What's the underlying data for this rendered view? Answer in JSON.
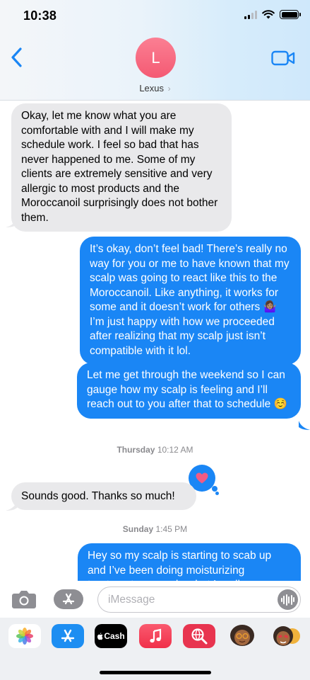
{
  "status_bar": {
    "time": "10:38"
  },
  "header": {
    "avatar_initial": "L",
    "contact_name": "Lexus",
    "name_chevron": "›"
  },
  "messages": [
    {
      "direction": "incoming",
      "text": "Okay, let me know what you are comfortable with and I will make my schedule work. I feel so bad that has never happened to me. Some of my clients are extremely sensitive and very allergic to most products and the Moroccanoil surprisingly does not bother them."
    },
    {
      "direction": "outgoing",
      "text": "It’s okay, don’t feel bad! There’s really no way for you or me to have known that my scalp was going to react like this to the Moroccanoil. Like anything, it works for some and it doesn’t work for others 🤷🏽‍♀️ I’m just happy with how we proceeded after realizing that my scalp just isn’t compatible with it lol."
    },
    {
      "direction": "outgoing",
      "text": "Let me get through the weekend so I can gauge how my scalp is feeling and I’ll reach out to you after that to schedule ☺️"
    },
    {
      "direction": "incoming",
      "text": "Sounds good. Thanks so much!",
      "tapback": "heart"
    },
    {
      "direction": "outgoing",
      "text": "Hey so my scalp is starting to scab up and I’ve been doing moisturizing treatments every day, but I really"
    }
  ],
  "timestamps": [
    {
      "day": "Thursday",
      "time": "10:12 AM"
    },
    {
      "day": "Sunday",
      "time": "1:45 PM"
    }
  ],
  "input": {
    "placeholder": "iMessage"
  },
  "app_strip": {
    "apps": [
      "photos-app",
      "app-store",
      "apple-cash",
      "music",
      "search-images",
      "memoji-stickers",
      "animoji"
    ],
    "cash_label": "Cash"
  },
  "colors": {
    "outgoing_bubble": "#1a86f5",
    "incoming_bubble": "#e9e9eb",
    "avatar": "#f45a73",
    "accent": "#1a86f5",
    "heart": "#f25b84"
  }
}
